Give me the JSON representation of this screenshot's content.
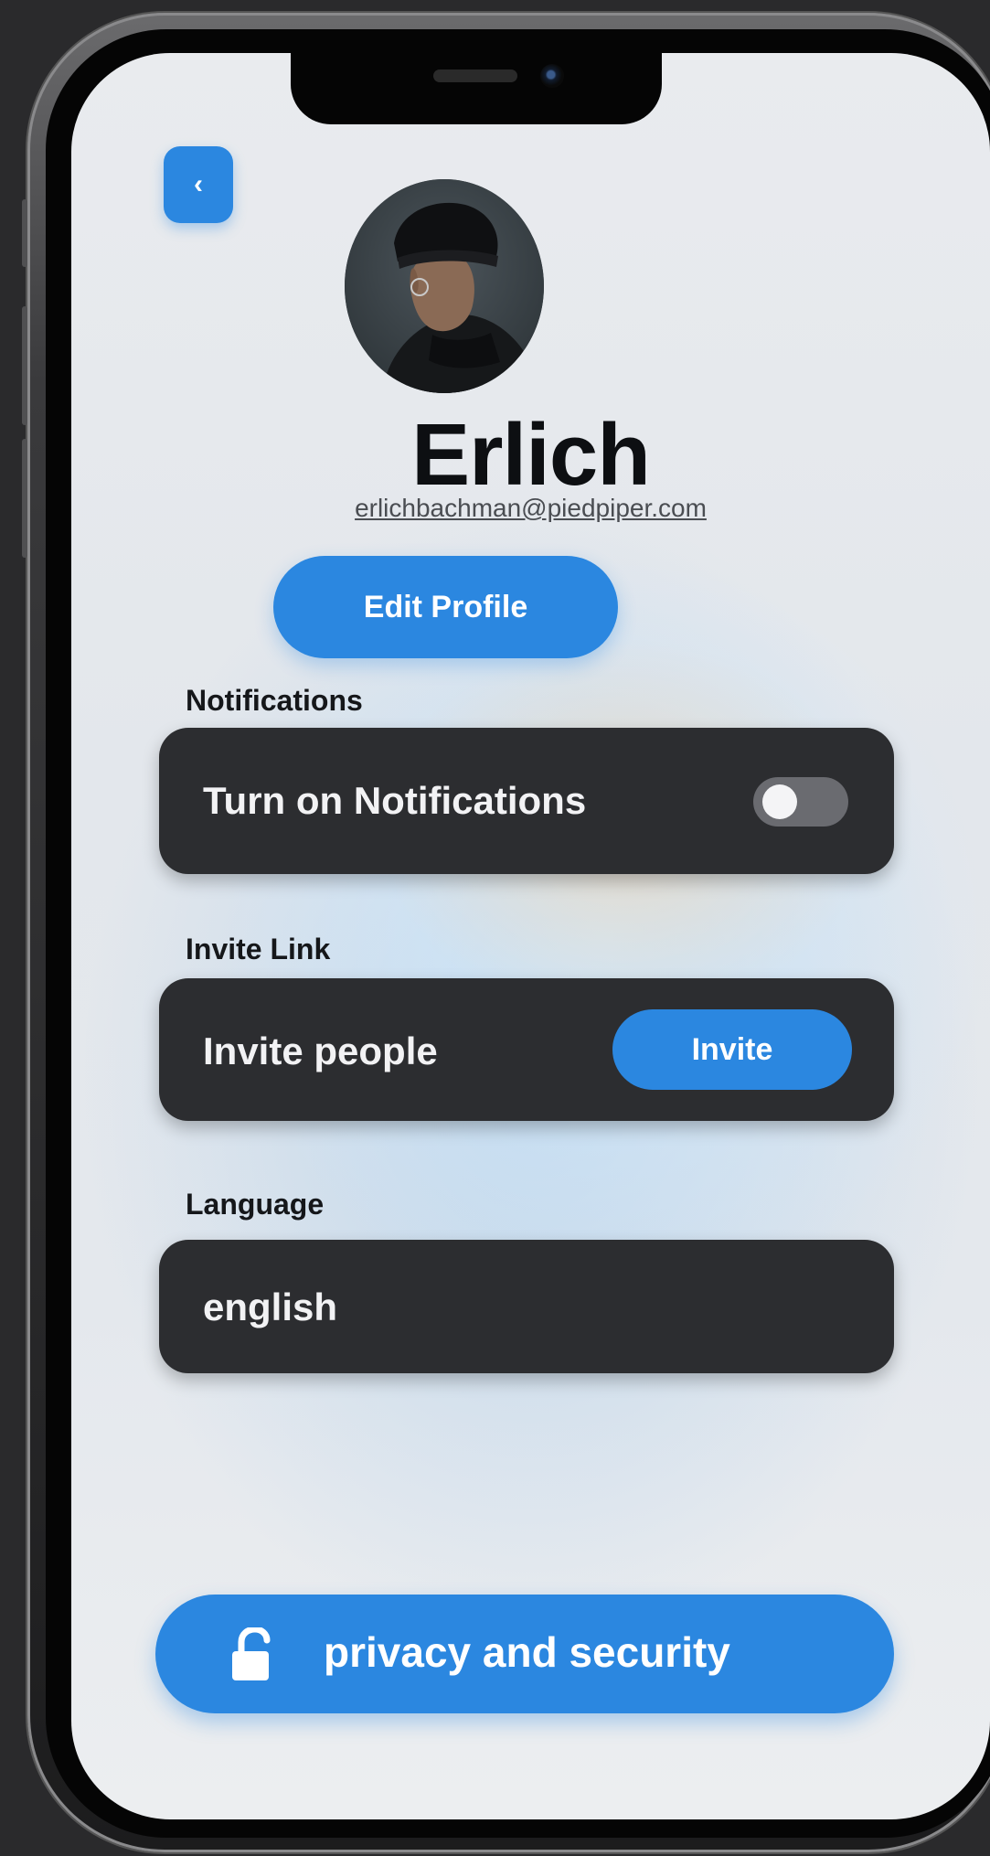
{
  "header": {
    "back_icon": "chevron-left-icon",
    "back_glyph": "‹"
  },
  "profile": {
    "avatar_icon": "profile-photo",
    "name": "Erlich",
    "email": "erlichbachman@piedpiper.com",
    "edit_label": "Edit Profile"
  },
  "notifications": {
    "section_label": "Notifications",
    "row_label": "Turn on Notifications",
    "enabled": false
  },
  "invite": {
    "section_label": "Invite Link",
    "row_label": "Invite people",
    "button_label": "Invite"
  },
  "language": {
    "section_label": "Language",
    "value": "english"
  },
  "privacy": {
    "icon": "unlocked-padlock-icon",
    "label": "privacy and security"
  },
  "colors": {
    "accent": "#2b87e0",
    "card": "#2c2d30",
    "background": "#e6e9ed"
  }
}
